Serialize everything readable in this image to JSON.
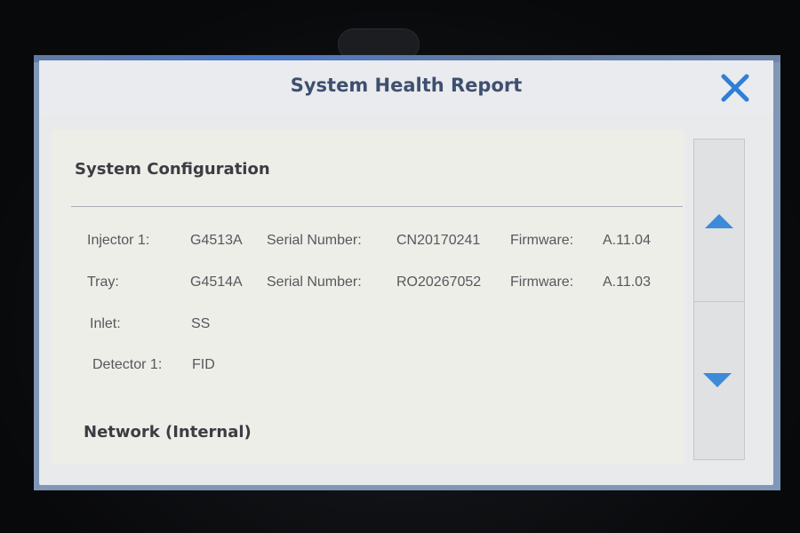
{
  "dialog": {
    "title": "System Health Report",
    "close_icon": "close-x-icon",
    "accent_color": "#3d8ad8"
  },
  "system_configuration": {
    "heading": "System Configuration",
    "rows": [
      {
        "label": "Injector 1:",
        "model": "G4513A",
        "serial_label": "Serial Number:",
        "serial": "CN20170241",
        "firmware_label": "Firmware:",
        "firmware": "A.11.04"
      },
      {
        "label": "Tray:",
        "model": "G4514A",
        "serial_label": "Serial Number:",
        "serial": "RO20267052",
        "firmware_label": "Firmware:",
        "firmware": "A.11.03"
      },
      {
        "label": "Inlet:",
        "model": "SS"
      },
      {
        "label": "Detector 1:",
        "model": "FID"
      }
    ]
  },
  "network_internal": {
    "heading": "Network (Internal)"
  },
  "scrollbar": {
    "up_icon": "triangle-up-icon",
    "down_icon": "triangle-down-icon"
  }
}
